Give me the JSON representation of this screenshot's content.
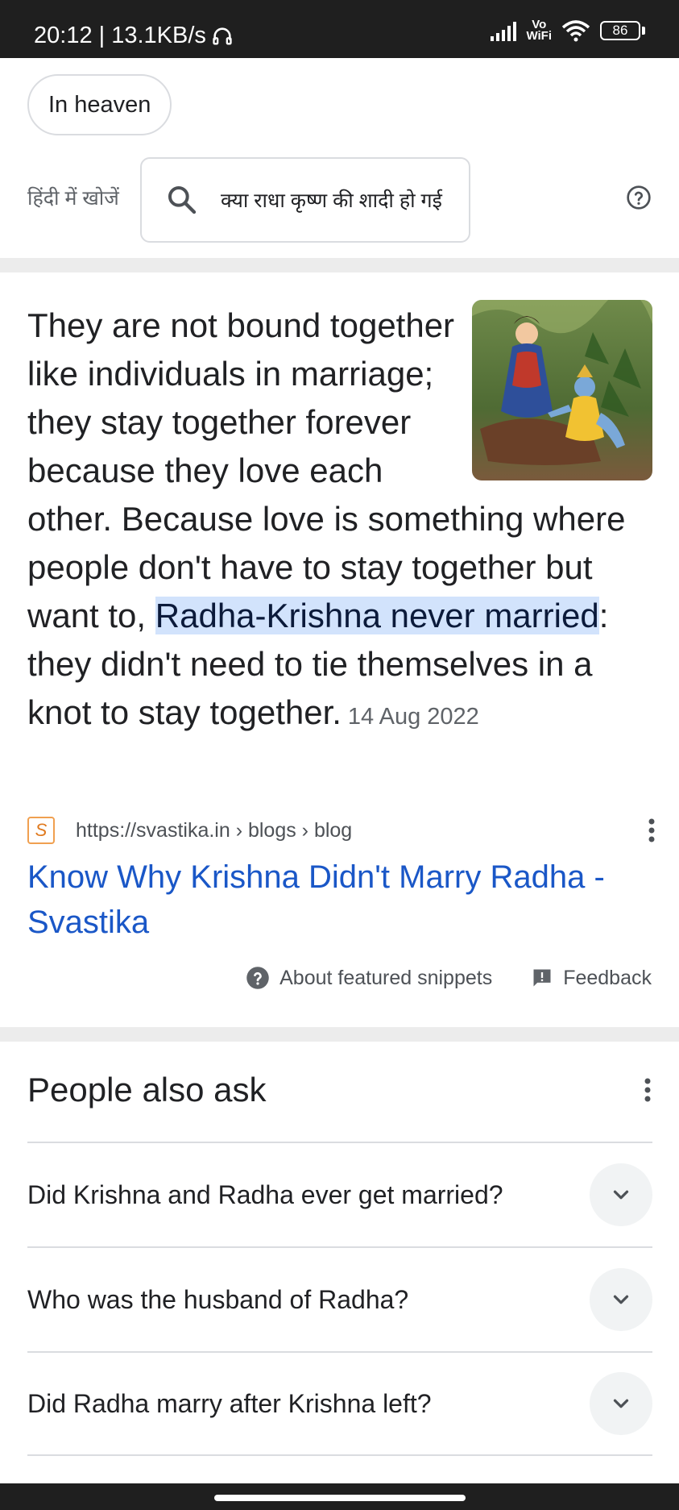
{
  "status_bar": {
    "time_speed": "20:12 | 13.1KB/s",
    "vowifi_top": "Vo",
    "vowifi_bottom": "WiFi",
    "battery": "86"
  },
  "chips": [
    {
      "label": "In heaven"
    }
  ],
  "hindi_search": {
    "label": "हिंदी में खोजें",
    "query": "क्या राधा कृष्ण की शादी हो गई"
  },
  "snippet": {
    "text_before": "They are not bound together like individuals in marriage; they stay together forever because they love each other. Because love is something where people don't have to stay together but want to, ",
    "highlight": "Radha-Krishna never married",
    "text_after": ": they didn't need to tie themselves in a knot to stay together.",
    "date": "14 Aug 2022",
    "source_url": "https://svastika.in › blogs › blog",
    "favicon_letter": "S",
    "title": "Know Why Krishna Didn't Marry Radha - Svastika",
    "about_label": "About featured snippets",
    "feedback_label": "Feedback"
  },
  "people_also_ask": {
    "title": "People also ask",
    "questions": [
      "Did Krishna and Radha ever get married?",
      "Who was the husband of Radha?",
      "Did Radha marry after Krishna left?"
    ]
  },
  "colors": {
    "link": "#1a57c7",
    "highlight_bg": "#d2e3fc",
    "status_bar_bg": "#1f1f1f"
  },
  "icons": {
    "status_headset": "headphones-icon",
    "signal": "signal-icon",
    "wifi": "wifi-icon",
    "battery": "battery-icon",
    "search": "search-icon",
    "help": "help-circle-icon",
    "menu": "more-vert-icon",
    "about": "question-circle-icon",
    "feedback": "feedback-icon",
    "expand": "chevron-down-icon"
  }
}
